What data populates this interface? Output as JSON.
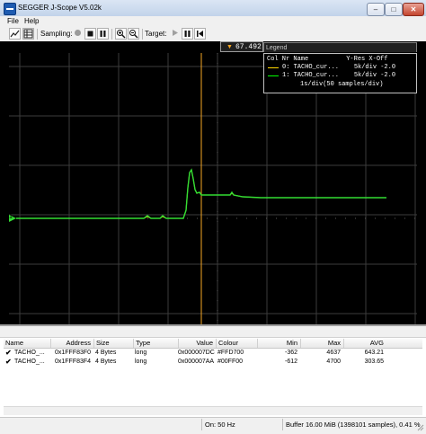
{
  "window": {
    "title": "SEGGER J-Scope V5.02k",
    "minimize": "–",
    "maximize": "□",
    "close": "✕"
  },
  "menu": {
    "file": "File",
    "help": "Help"
  },
  "toolbar": {
    "sampling_label": "Sampling:",
    "target_label": "Target:",
    "icons": [
      "graph-icon",
      "table-icon",
      "record-icon",
      "stop-icon",
      "pause-icon",
      "zoom-in-icon",
      "zoom-out-icon",
      "play-icon",
      "pause-icon",
      "skip-start-icon"
    ]
  },
  "scope": {
    "cursor_value": "67.492",
    "legend": {
      "title": "Legend",
      "header": "Col Nr Name          Y-Res X-Off",
      "rows": [
        {
          "text": "0: TACHO_cur...    5k/div -2.0",
          "color": "#FFD700"
        },
        {
          "text": "1: TACHO_cur...    5k/div -2.0",
          "color": "#00FF00"
        }
      ],
      "footer": "1s/div(50 samples/div)"
    },
    "channel_marker": "1",
    "colors": {
      "background": "#000000",
      "grid": "#3c3c3c",
      "cursor": "#F5A623",
      "trace": "#33DD33"
    }
  },
  "table": {
    "columns": [
      "Name",
      "Address",
      "Size",
      "Type",
      "Value",
      "Colour",
      "Min",
      "Max",
      "AVG"
    ],
    "rows": [
      {
        "name": "TACHO_...",
        "address": "0x1FFF83F0",
        "size": "4 Bytes",
        "type": "long",
        "value": "0x000007DC",
        "colour": "#FFD700",
        "min": "-362",
        "max": "4637",
        "avg": "643.21",
        "checked": true
      },
      {
        "name": "TACHO_...",
        "address": "0x1FFF83F4",
        "size": "4 Bytes",
        "type": "long",
        "value": "0x000007AA",
        "colour": "#00FF00",
        "min": "-612",
        "max": "4700",
        "avg": "303.65",
        "checked": true
      }
    ]
  },
  "status": {
    "frequency": "On: 50 Hz",
    "buffer": "Buffer 16.00 MiB (1398101 samples), 0.41 %"
  }
}
